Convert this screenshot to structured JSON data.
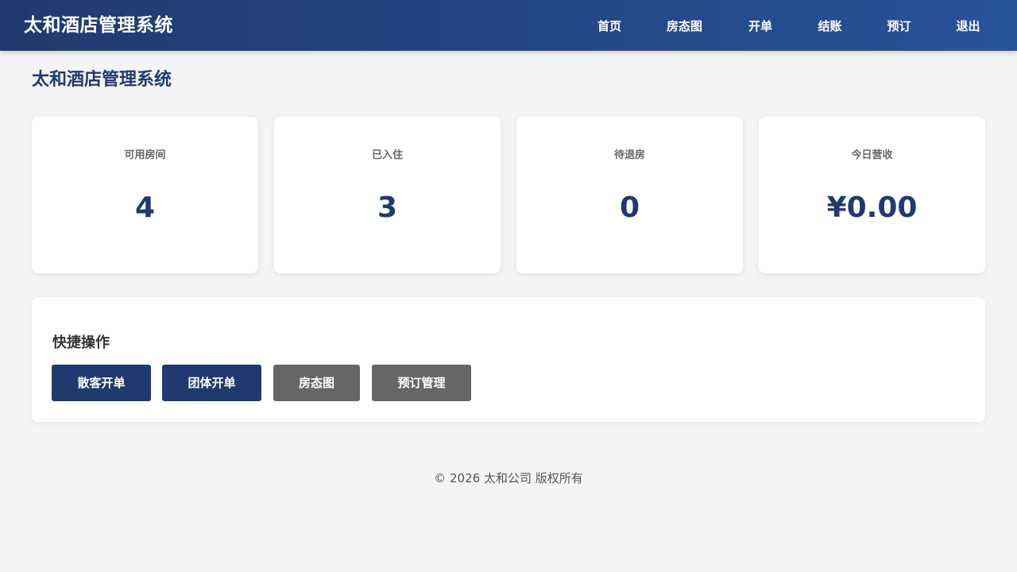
{
  "navbar": {
    "brand": "太和酒店管理系统",
    "items": [
      {
        "label": "首页"
      },
      {
        "label": "房态图"
      },
      {
        "label": "开单"
      },
      {
        "label": "结账"
      },
      {
        "label": "预订"
      },
      {
        "label": "退出"
      }
    ]
  },
  "page": {
    "title": "太和酒店管理系统"
  },
  "stats": [
    {
      "label": "可用房间",
      "value": "4"
    },
    {
      "label": "已入住",
      "value": "3"
    },
    {
      "label": "待退房",
      "value": "0"
    },
    {
      "label": "今日营收",
      "value": "¥0.00"
    }
  ],
  "quick_actions": {
    "title": "快捷操作",
    "buttons": [
      {
        "label": "散客开单"
      },
      {
        "label": "团体开单"
      },
      {
        "label": "房态图"
      },
      {
        "label": "预订管理"
      }
    ]
  },
  "footer": {
    "text": "© 2026 太和公司 版权所有"
  },
  "colors": {
    "nav_start": "#1f3a6e",
    "nav_end": "#28529a",
    "accent": "#1f3a6e",
    "secondary_button": "#666666",
    "background": "#f4f4f4"
  }
}
